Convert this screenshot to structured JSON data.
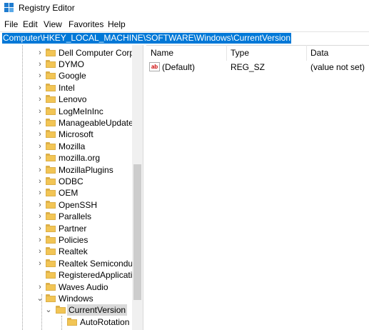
{
  "window": {
    "title": "Registry Editor"
  },
  "menu": {
    "items": [
      "File",
      "Edit",
      "View",
      "Favorites",
      "Help"
    ]
  },
  "address": {
    "path": "Computer\\HKEY_LOCAL_MACHINE\\SOFTWARE\\Windows\\CurrentVersion"
  },
  "tree": {
    "items": [
      {
        "label": "Dell Computer Corpo"
      },
      {
        "label": "DYMO"
      },
      {
        "label": "Google"
      },
      {
        "label": "Intel"
      },
      {
        "label": "Lenovo"
      },
      {
        "label": "LogMeInInc"
      },
      {
        "label": "ManageableUpdateP"
      },
      {
        "label": "Microsoft"
      },
      {
        "label": "Mozilla"
      },
      {
        "label": "mozilla.org"
      },
      {
        "label": "MozillaPlugins"
      },
      {
        "label": "ODBC"
      },
      {
        "label": "OEM"
      },
      {
        "label": "OpenSSH"
      },
      {
        "label": "Parallels"
      },
      {
        "label": "Partner"
      },
      {
        "label": "Policies"
      },
      {
        "label": "Realtek"
      },
      {
        "label": "Realtek Semiconduct"
      },
      {
        "label": "RegisteredApplicatio"
      },
      {
        "label": "Waves Audio"
      },
      {
        "label": "Windows"
      },
      {
        "label": "CurrentVersion"
      },
      {
        "label": "AutoRotation"
      }
    ]
  },
  "values_pane": {
    "columns": {
      "name": "Name",
      "type": "Type",
      "data": "Data"
    },
    "rows": [
      {
        "name": "(Default)",
        "type": "REG_SZ",
        "data": "(value not set)",
        "icon": "ab"
      }
    ]
  },
  "colors": {
    "selection": "#0078d7",
    "folder": "#f2c555"
  }
}
